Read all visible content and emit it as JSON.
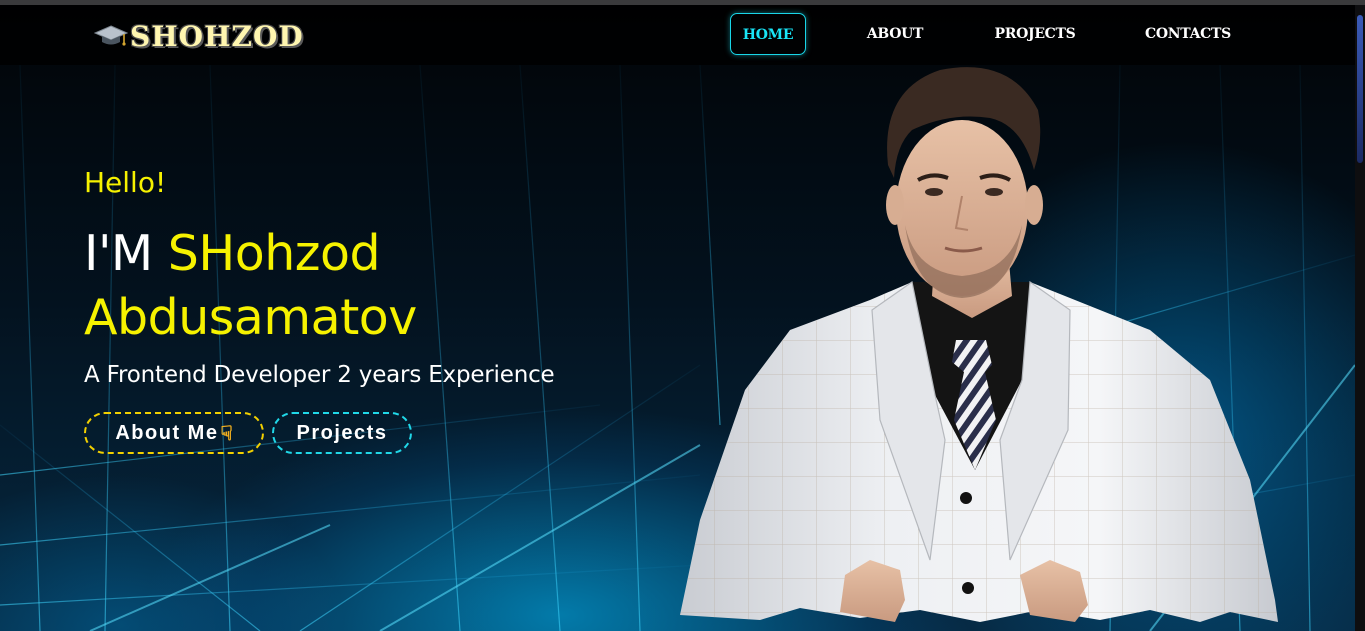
{
  "brand": {
    "name": "SHOHZOD",
    "icon": "graduation-cap-icon"
  },
  "nav": {
    "items": [
      {
        "label": "HOME",
        "active": true
      },
      {
        "label": "ABOUT",
        "active": false
      },
      {
        "label": "PROJECTS",
        "active": false
      },
      {
        "label": "CONTACTS",
        "active": false
      }
    ]
  },
  "hero": {
    "greeting": "Hello!",
    "intro": "I'M ",
    "name_first": "SHohzod",
    "name_last": "Abdusamatov",
    "subtitle": "A Frontend Developer 2 years Experience",
    "buttons": {
      "about": "About Me",
      "about_icon": "pointing-hand-icon",
      "projects": "Projects"
    }
  },
  "colors": {
    "accent_yellow": "#f6f200",
    "accent_cyan": "#19e4f5",
    "background": "#02070d"
  }
}
